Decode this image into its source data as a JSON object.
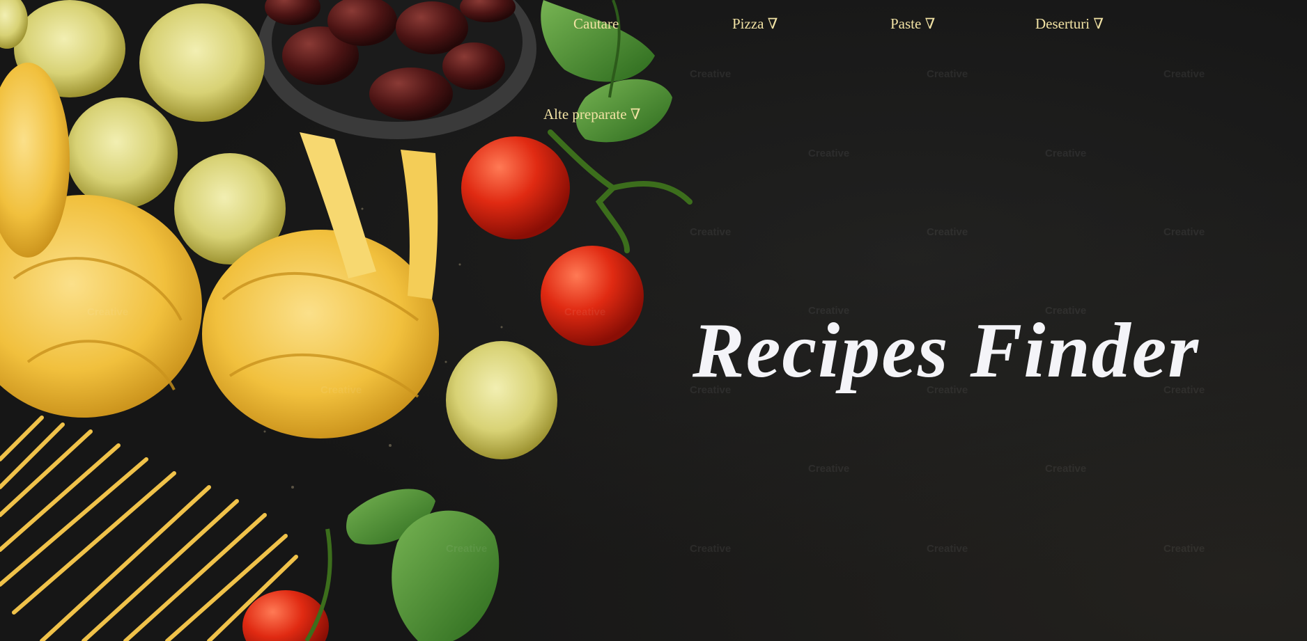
{
  "nav": {
    "items": [
      {
        "label": "Cautare"
      },
      {
        "label": "Pizza ∇"
      },
      {
        "label": "Paste ∇"
      },
      {
        "label": "Deserturi ∇"
      },
      {
        "label": "Alte preparate ∇"
      }
    ]
  },
  "hero": {
    "title": "Recipes Finder",
    "watermark_text": "Creative",
    "image": "pasta-tomatoes-basil-olives"
  },
  "colors": {
    "nav_text": "#f1e2a4",
    "title_text": "#f4f4f8",
    "background": "#161616"
  }
}
